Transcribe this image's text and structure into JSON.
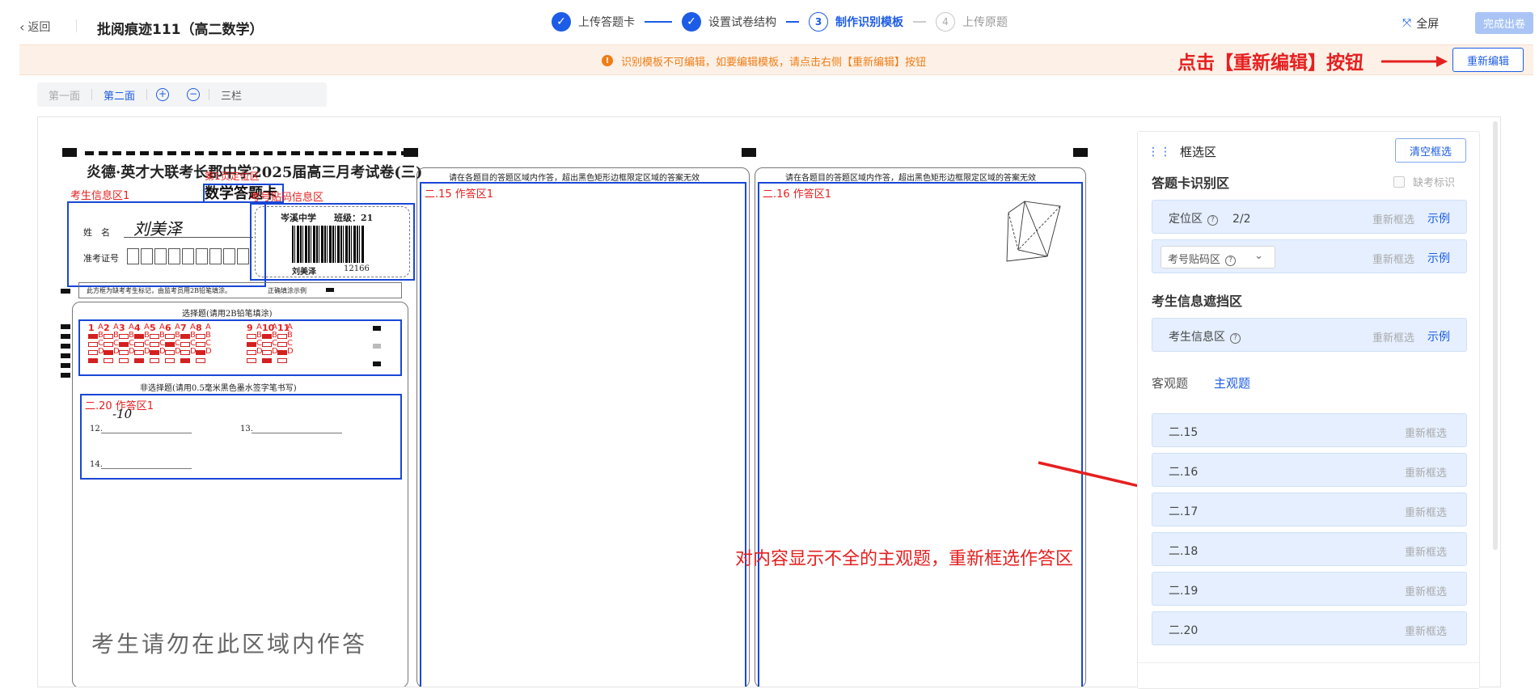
{
  "header": {
    "back_label": "返回",
    "title": "批阅痕迹111（高二数学）",
    "steps": [
      {
        "index": "✓",
        "label": "上传答题卡",
        "state": "done"
      },
      {
        "index": "✓",
        "label": "设置试卷结构",
        "state": "done"
      },
      {
        "index": "3",
        "label": "制作识别模板",
        "state": "active"
      },
      {
        "index": "4",
        "label": "上传原题",
        "state": "todo"
      }
    ],
    "fullscreen_label": "全屏",
    "finish_label": "完成出卷"
  },
  "notice": {
    "message": "识别模板不可编辑，如要编辑模板，请点击右侧【重新编辑】按钮",
    "annotation": "点击【重新编辑】按钮",
    "re_edit_label": "重新编辑"
  },
  "toolbar": {
    "page1": "第一面",
    "page2": "第二面",
    "zoom_in_icon": "zoom-in-icon",
    "zoom_out_icon": "zoom-out-icon",
    "columns": "三栏"
  },
  "sheet": {
    "title": "炎德·英才大联考长郡中学2025届高三月考试卷(三)",
    "subtitle": "数学答题卡",
    "name_label": "姓　名",
    "exam_no_label": "准考证号",
    "student_sign": "刘美泽",
    "school_class": "岑溪中学　　班级：21",
    "barcode_name": "刘美泽",
    "barcode_no": "12166",
    "absent_note": "此方框为缺考考生标记，由监考员用2B铅笔填涂。",
    "fill_example": "正确填涂示例",
    "choice_header": "选择题(请用2B铅笔填涂)",
    "nonchoice_header": "非选择题(请用0.5毫米黑色墨水签字笔书写)",
    "col_header": "请在各题目的答题区域内作答，超出黑色矩形边框限定区域的答案无效",
    "q12": "12.",
    "q13": "13.",
    "q14": "14.",
    "handwriting": "-10",
    "bottom_note": "考生请勿在此区域内作答",
    "red_labels": {
      "student_info": "考生信息区1",
      "locate": "第1页定位区",
      "barcode": "考号贴码信息区",
      "area15": "二.15 作答区1",
      "area16": "二.16 作答区1",
      "area20": "二.20 作答区1"
    },
    "choice_numbers": [
      "1",
      "2",
      "3",
      "4",
      "5",
      "6",
      "7",
      "8",
      "9",
      "10",
      "11"
    ],
    "choice_options": [
      "A",
      "B",
      "C",
      "D"
    ],
    "annotation": "对内容显示不全的主观题，重新框选作答区"
  },
  "panel": {
    "head": "框选区",
    "clear_label": "清空框选",
    "section_card": "答题卡识别区",
    "missing_label": "缺考标识",
    "rows": [
      {
        "label": "定位区",
        "count": "2/2",
        "reselect": "重新框选",
        "example": "示例"
      },
      {
        "label": "考号贴码区",
        "reselect": "重新框选",
        "example": "示例"
      }
    ],
    "section_mask": "考生信息遮挡区",
    "mask_row": {
      "label": "考生信息区",
      "reselect": "重新框选",
      "example": "示例"
    },
    "tabs": [
      "客观题",
      "主观题"
    ],
    "subjective": [
      {
        "label": "二.15",
        "reselect": "重新框选"
      },
      {
        "label": "二.16",
        "reselect": "重新框选"
      },
      {
        "label": "二.17",
        "reselect": "重新框选"
      },
      {
        "label": "二.18",
        "reselect": "重新框选"
      },
      {
        "label": "二.19",
        "reselect": "重新框选"
      },
      {
        "label": "二.20",
        "reselect": "重新框选"
      }
    ]
  },
  "colors": {
    "primary": "#1c5ce6",
    "warning": "#f07d16",
    "annotation_red": "#e52020",
    "box_blue": "#1947d6"
  }
}
